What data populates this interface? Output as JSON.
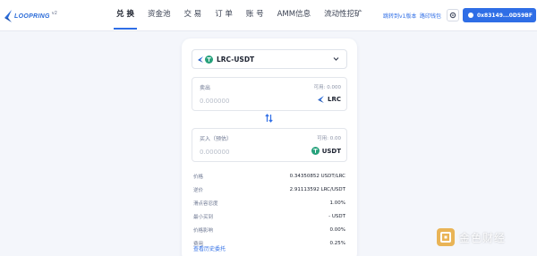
{
  "brand": {
    "name": "LOOPRING",
    "version": "v2"
  },
  "nav": {
    "items": [
      "兑 换",
      "资金池",
      "交 易",
      "订 单",
      "账 号",
      "AMM信息",
      "流动性挖矿"
    ],
    "active_index": 0
  },
  "header": {
    "v1_link": "跳转到v1版本",
    "wallet_link": "路印钱包",
    "wallet_button": "0x83149...0D59BF"
  },
  "swap": {
    "pair": "LRC-USDT",
    "sell": {
      "label": "卖出",
      "balance": "可用: 0.000",
      "amount_placeholder": "0.000000",
      "token": "LRC"
    },
    "buy": {
      "label": "买入（预估）",
      "balance": "可用: 0.00",
      "amount_placeholder": "0.000000",
      "token": "USDT"
    },
    "details": [
      {
        "key": "价格",
        "value": "0.34350852 USDT/LRC"
      },
      {
        "key": "逆价",
        "value": "2.91113592 LRC/USDT"
      },
      {
        "key": "滑点容忍度",
        "value": "1.00%"
      },
      {
        "key": "最小买到",
        "value": "- USDT"
      },
      {
        "key": "价格影响",
        "value": "0.00%"
      },
      {
        "key": "费用",
        "value": "0.25%"
      }
    ],
    "history_link": "查看历史委托"
  },
  "watermark": {
    "text": "金色财经"
  },
  "colors": {
    "accent": "#2f6ee6",
    "tether": "#26a17b",
    "loopring": "#2a6bd8"
  },
  "icons": [
    "loopring-logo-icon",
    "gear-icon",
    "user-icon",
    "chevron-down-icon",
    "tether-icon",
    "loopring-token-icon",
    "swap-arrows-icon",
    "watermark-logo-icon"
  ]
}
